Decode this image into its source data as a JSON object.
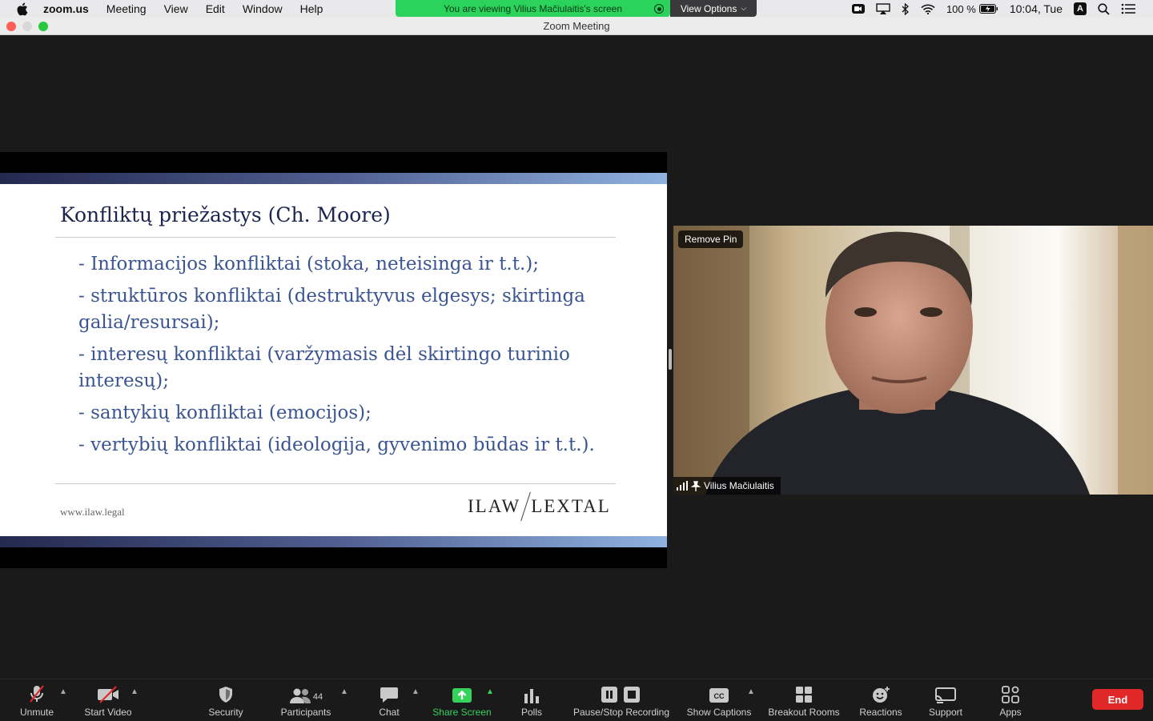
{
  "menubar": {
    "app_name": "zoom.us",
    "items": [
      "Meeting",
      "View",
      "Edit",
      "Window",
      "Help"
    ],
    "share_banner": "You are viewing Vilius Mačiulaitis's screen",
    "view_options": "View Options",
    "battery": "100 %",
    "clock": "10:04, Tue",
    "input_source": "A"
  },
  "window": {
    "title": "Zoom Meeting"
  },
  "slide": {
    "title": "Konfliktų priežastys (Ch. Moore)",
    "bullets": [
      "- Informacijos konfliktai (stoka, neteisinga ir t.t.);",
      "- struktūros konfliktai (destruktyvus elgesys; skirtinga galia/resursai);",
      "- interesų konfliktai (varžymasis dėl skirtingo turinio interesų);",
      "- santykių konfliktai (emocijos);",
      "- vertybių konfliktai (ideologija, gyvenimo būdas ir t.t.)."
    ],
    "url": "www.ilaw.legal",
    "logo_left": "ILAW",
    "logo_right": "LEXTAL"
  },
  "video": {
    "remove_pin": "Remove Pin",
    "participant_name": "Vilius Mačiulaitis"
  },
  "toolbar": {
    "unmute": "Unmute",
    "start_video": "Start Video",
    "security": "Security",
    "participants": "Participants",
    "participants_count": "44",
    "chat": "Chat",
    "share_screen": "Share Screen",
    "polls": "Polls",
    "recording": "Pause/Stop Recording",
    "captions": "Show Captions",
    "breakout": "Breakout Rooms",
    "reactions": "Reactions",
    "support": "Support",
    "apps": "Apps",
    "end": "End"
  },
  "colors": {
    "share_green": "#2bd25c",
    "end_red": "#e02828",
    "slide_title": "#1c2550",
    "slide_text": "#3a5591"
  }
}
